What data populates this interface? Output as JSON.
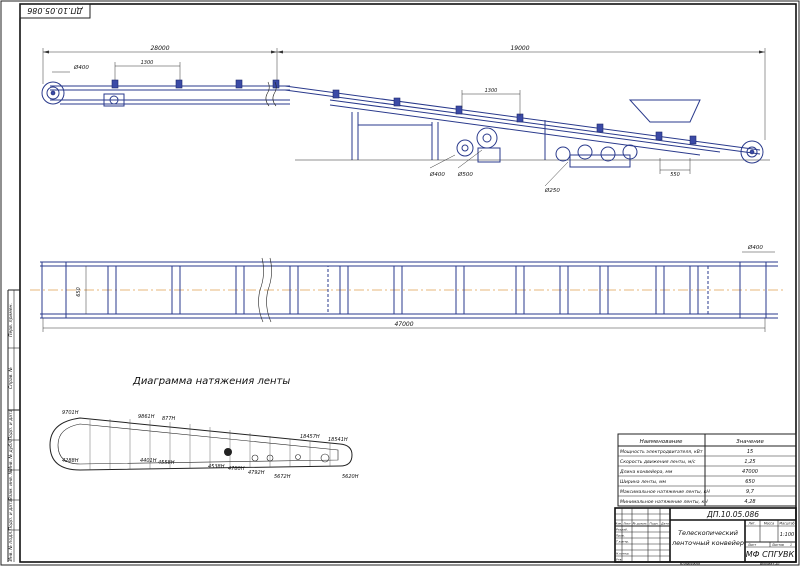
{
  "doc_code_rotated": "ДП.10.05.086",
  "dims": {
    "top_left_span": "28000",
    "top_right_span": "19000",
    "pitch_left": "1300",
    "pitch_right": "1300",
    "d400_left": "Ø400",
    "d400_bottom": "Ø400",
    "d500": "Ø500",
    "d250": "Ø250",
    "gap_550": "550",
    "plan_width": "650",
    "plan_total": "47000",
    "plan_d400": "Ø400"
  },
  "diagram": {
    "title": "Диаграмма натяжения ленты",
    "labels": {
      "l9701": "9701Н",
      "l9861": "9861Н",
      "l8770": "877Н",
      "l4288": "4288Н",
      "l4401": "4401Н",
      "l4558": "4558Н",
      "l4538": "4538Н",
      "l4780": "4780Н",
      "l4792": "4792Н",
      "l5672": "5672Н",
      "l18457": "18457Н",
      "l18541": "18541Н",
      "l5620": "5620Н"
    }
  },
  "spec_table": {
    "headers": [
      "Наименование",
      "Значение"
    ],
    "rows": [
      [
        "Мощность электродвигателя, кВт",
        "15"
      ],
      [
        "Скорость движения ленты, м/с",
        "1,25"
      ],
      [
        "Длина конвейера, мм",
        "47000"
      ],
      [
        "Ширина ленты, мм",
        "650"
      ],
      [
        "Максимальное натяжение ленты, кН",
        "9,7"
      ],
      [
        "Минимальное натяжение ленты, кН",
        "4,28"
      ]
    ]
  },
  "title_block": {
    "code": "ДП.10.05.086",
    "name_line1": "Телескопический",
    "name_line2": "ленточный конвейер",
    "org": "МФ СПГУВК",
    "col_headers": [
      "Изм.",
      "Лист",
      "№ докум.",
      "Подп.",
      "Дата"
    ],
    "role_labels": [
      "Разраб.",
      "Пров.",
      "Т.контр.",
      "",
      "Н.контр.",
      "Утв."
    ],
    "lit_header": "Лит.",
    "mass_header": "Масса",
    "scale_header": "Масштаб",
    "scale_value": "1:100",
    "sheet_label": "Лист",
    "sheets_label": "Листов",
    "sheets_value": "1",
    "copied": "Копировал",
    "format": "Формат A1"
  },
  "side_strip": [
    "Перв. примен.",
    "Справ. №",
    "Подп. и дата",
    "Инв. № дубл.",
    "Взам. инв. №",
    "Подп. и дата",
    "Инв. № подл."
  ]
}
